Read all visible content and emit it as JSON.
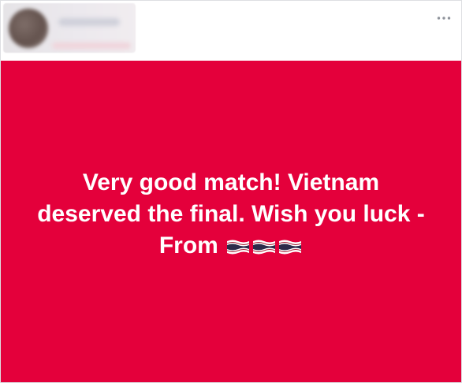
{
  "post": {
    "header": {
      "author_name": "",
      "more_icon": "more-horizontal-icon"
    },
    "status": {
      "text": "Very good match! Vietnam deserved the final. Wish you luck - From",
      "emoji": [
        "flag-thailand",
        "flag-thailand",
        "flag-thailand"
      ],
      "background_color": "#e4003b",
      "text_color": "#ffffff"
    }
  }
}
